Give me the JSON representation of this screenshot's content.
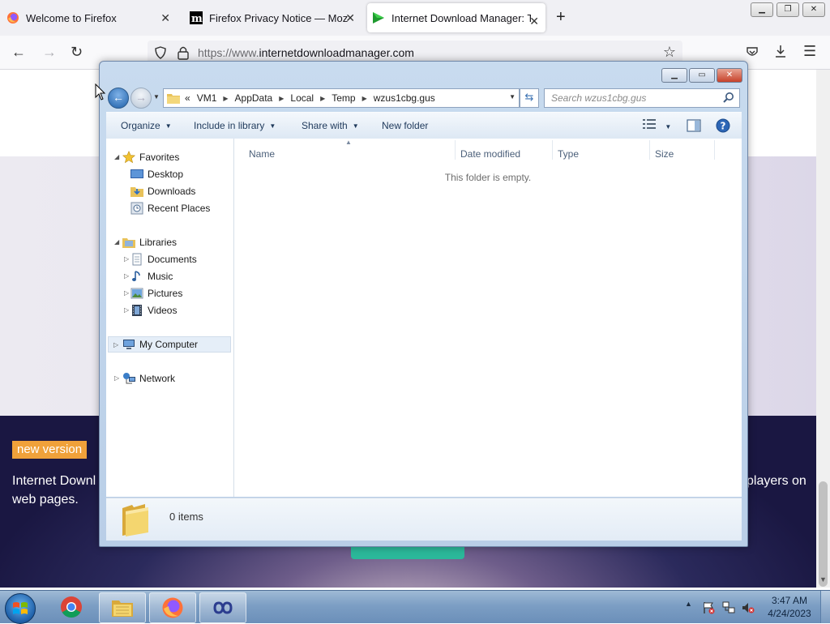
{
  "browser": {
    "tabs": [
      {
        "label": "Welcome to Firefox",
        "favicon": "firefox-icon",
        "active": false
      },
      {
        "label": "Firefox Privacy Notice — Mozilla",
        "favicon": "mozilla-m-icon",
        "active": false
      },
      {
        "label": "Internet Download Manager: Th",
        "favicon": "idm-arrow-icon",
        "active": true
      }
    ],
    "url": {
      "prefix": "https://www.",
      "domain": "internetdownloadmanager.com"
    }
  },
  "page": {
    "badge": "new version",
    "text_left": "Internet Downl web pages.",
    "text_right": "players on"
  },
  "explorer": {
    "breadcrumb": [
      "«",
      "VM1",
      "AppData",
      "Local",
      "Temp",
      "wzus1cbg.gus"
    ],
    "search_placeholder": "Search wzus1cbg.gus",
    "toolbar": {
      "organize": "Organize",
      "include_in_library": "Include in library",
      "share_with": "Share with",
      "new_folder": "New folder"
    },
    "nav": {
      "favorites": {
        "label": "Favorites",
        "items": [
          "Desktop",
          "Downloads",
          "Recent Places"
        ]
      },
      "libraries": {
        "label": "Libraries",
        "items": [
          "Documents",
          "Music",
          "Pictures",
          "Videos"
        ]
      },
      "computer": "My Computer",
      "network": "Network"
    },
    "columns": [
      "Name",
      "Date modified",
      "Type",
      "Size"
    ],
    "empty_message": "This folder is empty.",
    "status": "0 items"
  },
  "taskbar": {
    "apps": [
      "chrome",
      "windows-explorer",
      "firefox",
      "teamviewer-like"
    ],
    "clock": {
      "time": "3:47 AM",
      "date": "4/24/2023"
    }
  }
}
